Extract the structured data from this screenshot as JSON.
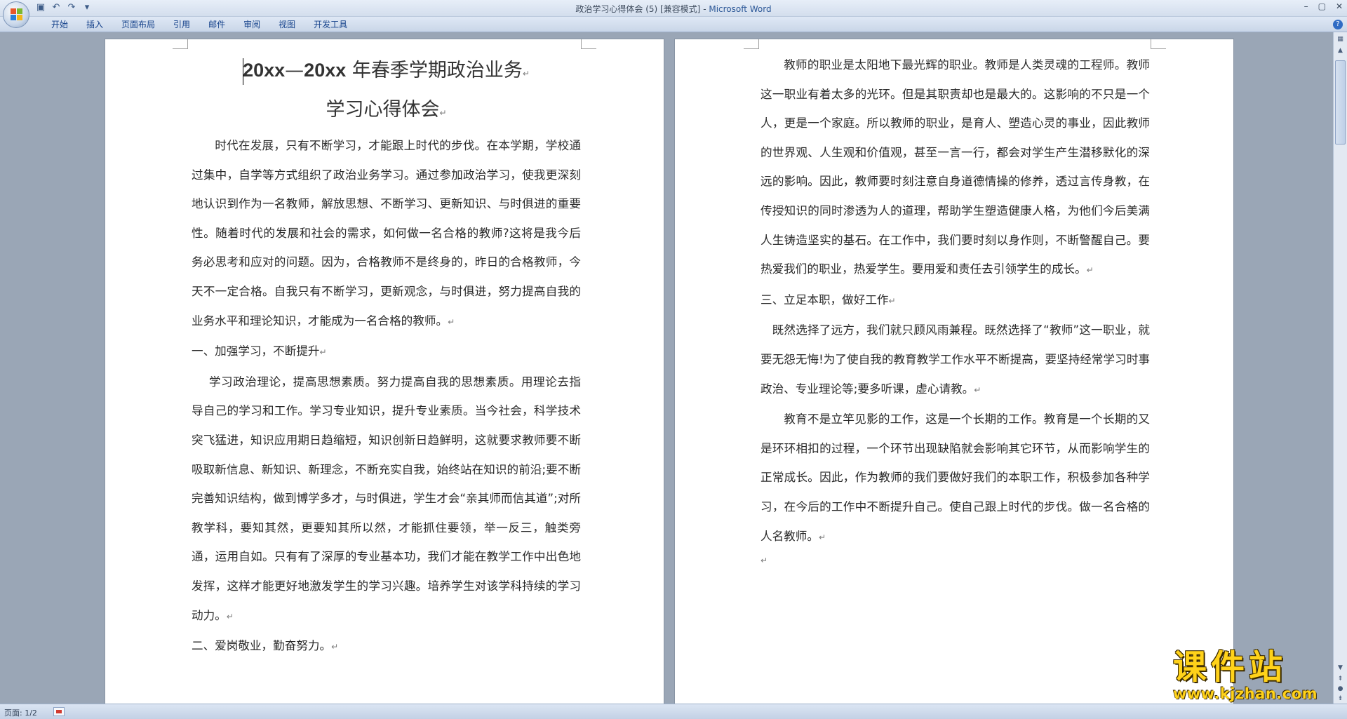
{
  "window": {
    "doc_name": "政治学习心得体会 (5) [兼容模式]",
    "separator": " - ",
    "app_name": "Microsoft Word",
    "controls": [
      "–",
      "▢",
      "✕"
    ]
  },
  "quick_access": {
    "icons": [
      "save-icon",
      "undo-icon",
      "redo-icon",
      "customize-icon"
    ]
  },
  "ribbon": {
    "tabs": [
      "开始",
      "插入",
      "页面布局",
      "引用",
      "邮件",
      "审阅",
      "视图",
      "开发工具"
    ]
  },
  "document": {
    "title_line1_latin1": "20xx",
    "title_line1_dash": "—",
    "title_line1_latin2": "20xx",
    "title_line1_rest": " 年春季学期政治业务",
    "title_line2": "学习心得体会",
    "para_mark": "↵",
    "left_page": {
      "intro": "时代在发展，只有不断学习，才能跟上时代的步伐。在本学期，学校通过集中，自学等方式组织了政治业务学习。通过参加政治学习，使我更深刻地认识到作为一名教师，解放思想、不断学习、更新知识、与时俱进的重要性。随着时代的发展和社会的需求，如何做一名合格的教师?这将是我今后务必思考和应对的问题。因为，合格教师不是终身的，昨日的合格教师，今天不一定合格。自我只有不断学习，更新观念，与时俱进，努力提高自我的业务水平和理论知识，才能成为一名合格的教师。",
      "heading1": "一、加强学习，不断提升",
      "para1": "学习政治理论，提高思想素质。努力提高自我的思想素质。用理论去指导自己的学习和工作。学习专业知识，提升专业素质。当今社会，科学技术突飞猛进，知识应用期日趋缩短，知识创新日趋鲜明，这就要求教师要不断吸取新信息、新知识、新理念，不断充实自我，始终站在知识的前沿;要不断完善知识结构，做到博学多才，与时俱进，学生才会“亲其师而信其道”;对所教学科，要知其然，更要知其所以然，才能抓住要领，举一反三，触类旁通，运用自如。只有有了深厚的专业基本功，我们才能在教学工作中出色地发挥，这样才能更好地激发学生的学习兴趣。培养学生对该学科持续的学习动力。",
      "heading2": "二、爱岗敬业，勤奋努力。"
    },
    "right_page": {
      "para1": "教师的职业是太阳地下最光辉的职业。教师是人类灵魂的工程师。教师这一职业有着太多的光环。但是其职责却也是最大的。这影响的不只是一个人，更是一个家庭。所以教师的职业，是育人、塑造心灵的事业，因此教师的世界观、人生观和价值观，甚至一言一行，都会对学生产生潜移默化的深远的影响。因此，教师要时刻注意自身道德情操的修养，透过言传身教，在传授知识的同时渗透为人的道理，帮助学生塑造健康人格，为他们今后美满人生铸造坚实的基石。在工作中，我们要时刻以身作则，不断警醒自己。要热爱我们的职业，热爱学生。要用爱和责任去引领学生的成长。",
      "heading3": "三、立足本职，做好工作",
      "para2": "既然选择了远方，我们就只顾风雨兼程。既然选择了“教师”这一职业，就要无怨无悔!为了使自我的教育教学工作水平不断提高，要坚持经常学习时事政治、专业理论等;要多听课，虚心请教。",
      "para3": "教育不是立竿见影的工作，这是一个长期的工作。教育是一个长期的又是环环相扣的过程，一个环节出现缺陷就会影响其它环节，从而影响学生的正常成长。因此，作为教师的我们要做好我们的本职工作，积极参加各种学习，在今后的工作中不断提升自己。使自己跟上时代的步伐。做一名合格的人名教师。"
    }
  },
  "status": {
    "page": "页面: 1/2"
  },
  "watermark": {
    "cn": "课件站",
    "url": "www.kjzhan.com"
  },
  "colors": {
    "ribbon_tab": "#15428b",
    "workspace": "#9aa6b6",
    "watermark": "#ffd21a"
  }
}
